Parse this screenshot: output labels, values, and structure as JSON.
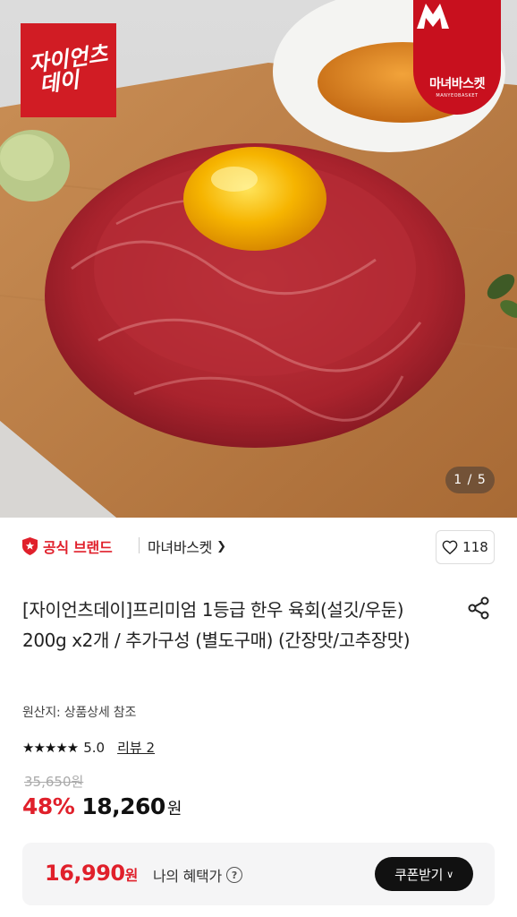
{
  "gallery": {
    "pager_current": "1",
    "pager_sep": " / ",
    "pager_total": "5",
    "logo_left_line1": "자이언츠",
    "logo_left_line2": "데이",
    "logo_right_name": "마녀바스켓",
    "logo_right_sub": "MANYEOBASKET"
  },
  "brand": {
    "official_label": "공식 브랜드",
    "store_name": "마녀바스켓",
    "likes": "118"
  },
  "product": {
    "title": "[자이언츠데이]프리미엄 1등급 한우 육회(설깃/우둔) 200g x2개 / 추가구성 (별도구매) (간장맛/고추장맛)",
    "origin": "원산지: 상품상세 참조",
    "stars": "★★★★★",
    "rating": "5.0",
    "review_link": "리뷰 2",
    "original_price": "35,650원",
    "discount": "48%",
    "price": "18,260",
    "price_unit": "원"
  },
  "benefit": {
    "price": "16,990",
    "unit": "원",
    "label": "나의 혜택가",
    "help_icon_text": "?",
    "coupon_button": "쿠폰받기"
  },
  "colors": {
    "accent_red": "#e0202b",
    "button_dark": "#111111"
  }
}
